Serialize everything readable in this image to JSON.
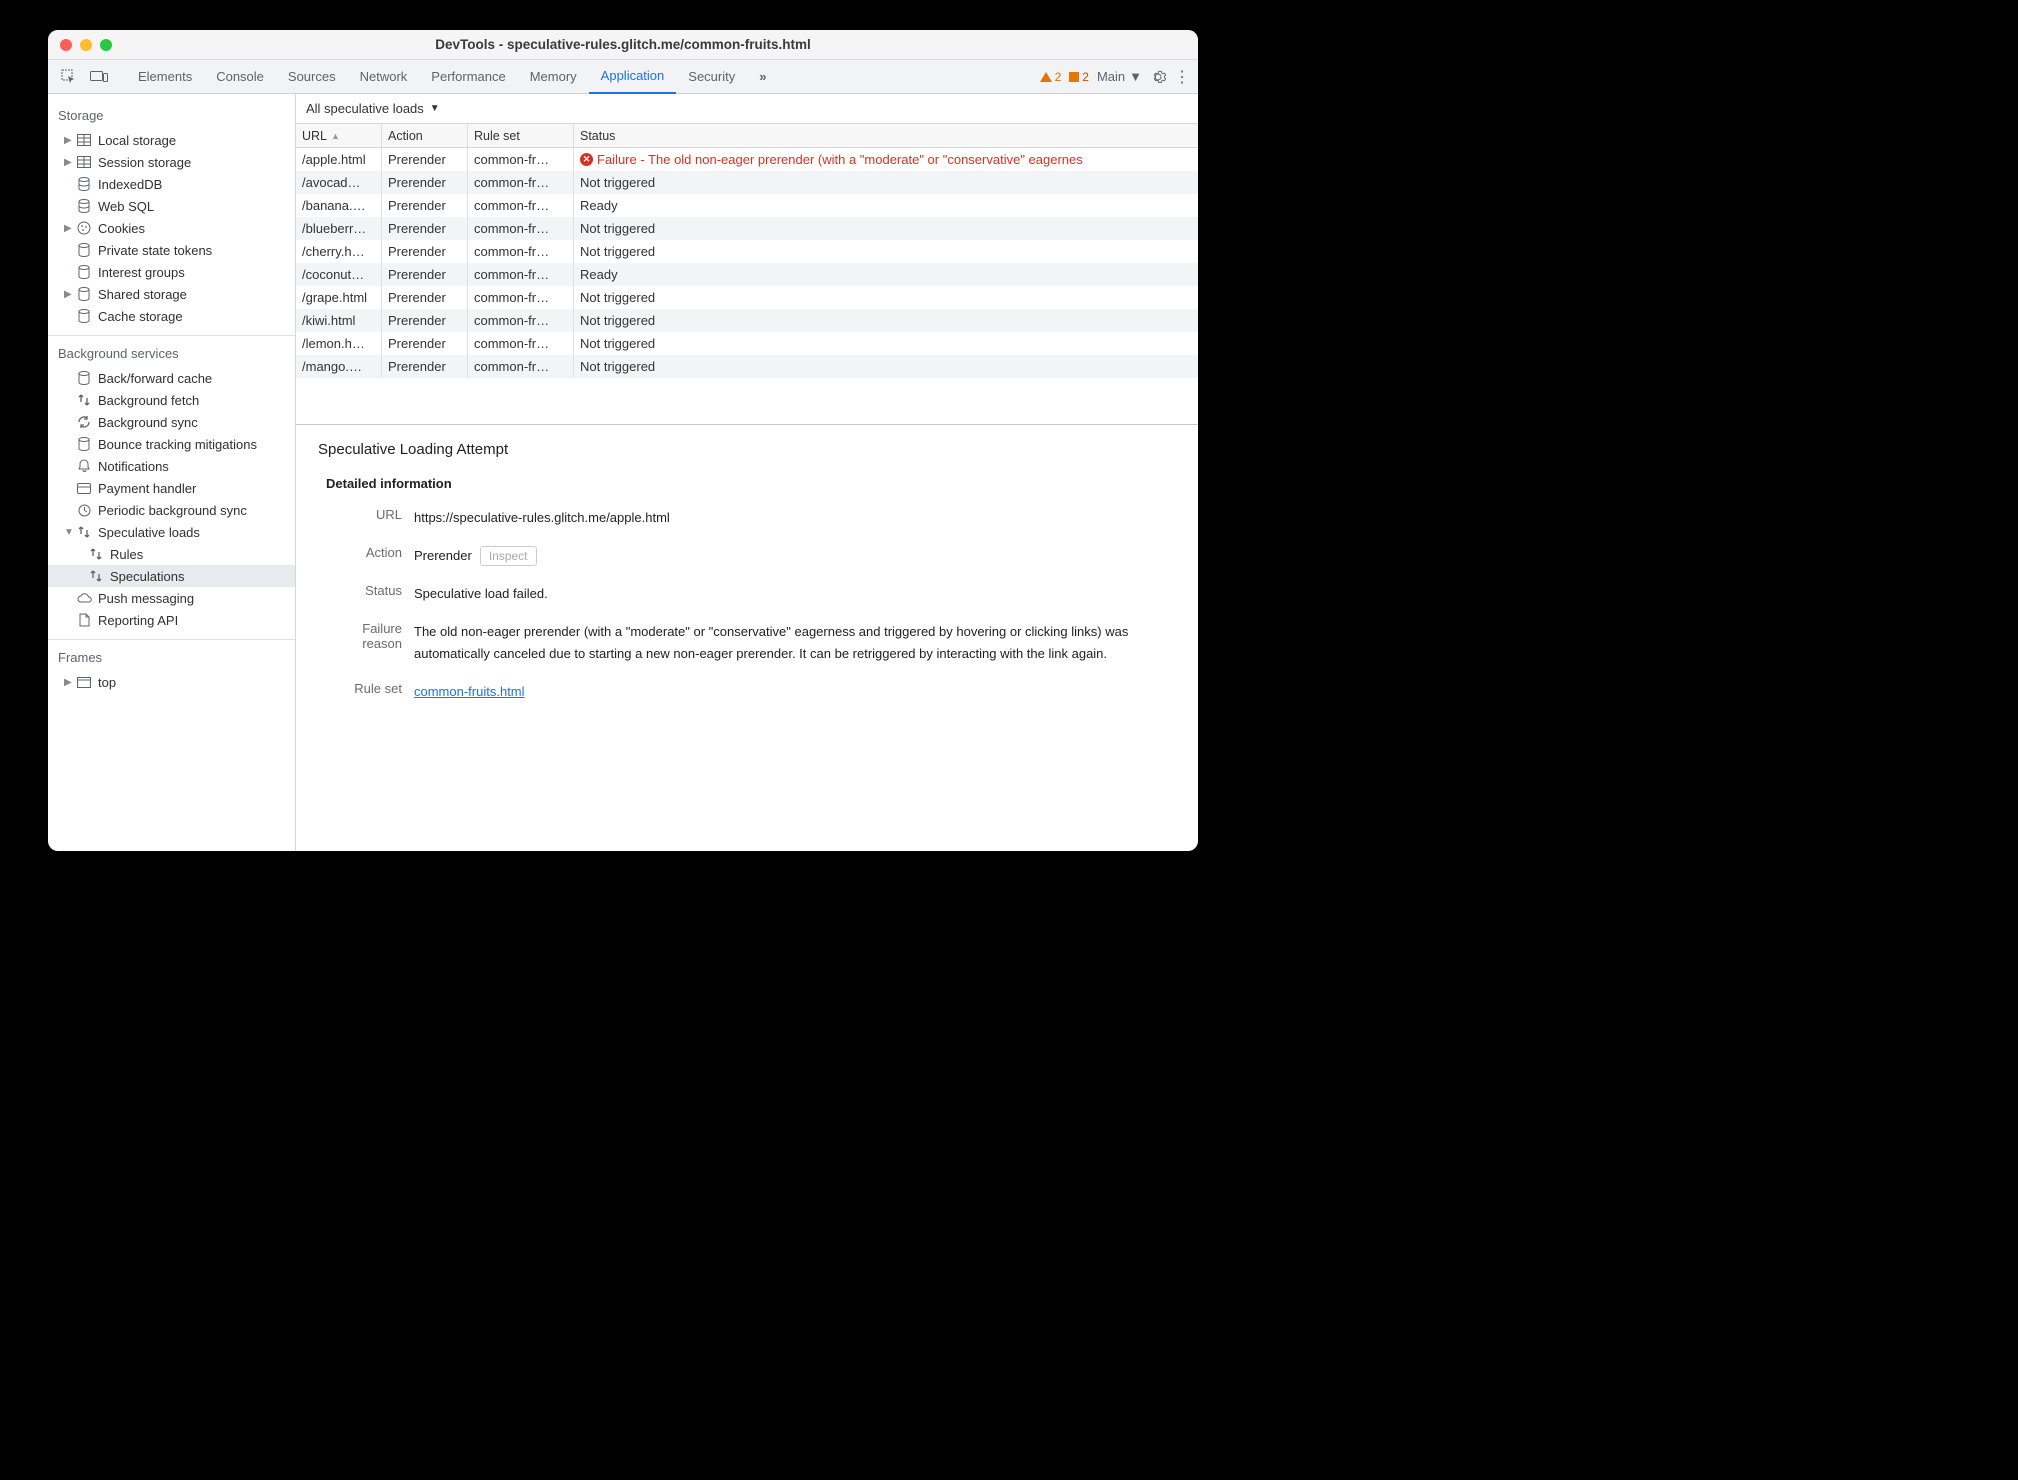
{
  "window": {
    "title": "DevTools - speculative-rules.glitch.me/common-fruits.html"
  },
  "tabs": [
    "Elements",
    "Console",
    "Sources",
    "Network",
    "Performance",
    "Memory",
    "Application",
    "Security"
  ],
  "active_tab": "Application",
  "overflow_icon": "»",
  "warn_count": "2",
  "issue_count": "2",
  "target_sel": "Main",
  "sidebar": {
    "storage_h": "Storage",
    "storage": [
      "Local storage",
      "Session storage",
      "IndexedDB",
      "Web SQL",
      "Cookies",
      "Private state tokens",
      "Interest groups",
      "Shared storage",
      "Cache storage"
    ],
    "bg_h": "Background services",
    "bg": [
      "Back/forward cache",
      "Background fetch",
      "Background sync",
      "Bounce tracking mitigations",
      "Notifications",
      "Payment handler",
      "Periodic background sync",
      "Speculative loads",
      "Rules",
      "Speculations",
      "Push messaging",
      "Reporting API"
    ],
    "frames_h": "Frames",
    "frames": [
      "top"
    ]
  },
  "filter": "All speculative loads",
  "cols": {
    "url": "URL",
    "action": "Action",
    "ruleset": "Rule set",
    "status": "Status"
  },
  "rows": [
    {
      "url": "/apple.html",
      "action": "Prerender",
      "ruleset": "common-fr…",
      "status": "Failure - The old non-eager prerender (with a \"moderate\" or \"conservative\" eagernes",
      "fail": true
    },
    {
      "url": "/avocad…",
      "action": "Prerender",
      "ruleset": "common-fr…",
      "status": "Not triggered"
    },
    {
      "url": "/banana.…",
      "action": "Prerender",
      "ruleset": "common-fr…",
      "status": "Ready"
    },
    {
      "url": "/blueberr…",
      "action": "Prerender",
      "ruleset": "common-fr…",
      "status": "Not triggered"
    },
    {
      "url": "/cherry.h…",
      "action": "Prerender",
      "ruleset": "common-fr…",
      "status": "Not triggered"
    },
    {
      "url": "/coconut…",
      "action": "Prerender",
      "ruleset": "common-fr…",
      "status": "Ready"
    },
    {
      "url": "/grape.html",
      "action": "Prerender",
      "ruleset": "common-fr…",
      "status": "Not triggered"
    },
    {
      "url": "/kiwi.html",
      "action": "Prerender",
      "ruleset": "common-fr…",
      "status": "Not triggered"
    },
    {
      "url": "/lemon.h…",
      "action": "Prerender",
      "ruleset": "common-fr…",
      "status": "Not triggered"
    },
    {
      "url": "/mango.…",
      "action": "Prerender",
      "ruleset": "common-fr…",
      "status": "Not triggered"
    }
  ],
  "detail": {
    "title": "Speculative Loading Attempt",
    "section": "Detailed information",
    "labels": {
      "url": "URL",
      "action": "Action",
      "status": "Status",
      "fail": "Failure reason",
      "ruleset": "Rule set"
    },
    "url": "https://speculative-rules.glitch.me/apple.html",
    "action": "Prerender",
    "inspect": "Inspect",
    "status": "Speculative load failed.",
    "fail_reason": "The old non-eager prerender (with a \"moderate\" or \"conservative\" eagerness and triggered by hovering or clicking links) was automatically canceled due to starting a new non-eager prerender. It can be retriggered by interacting with the link again.",
    "ruleset_link": "common-fruits.html"
  }
}
